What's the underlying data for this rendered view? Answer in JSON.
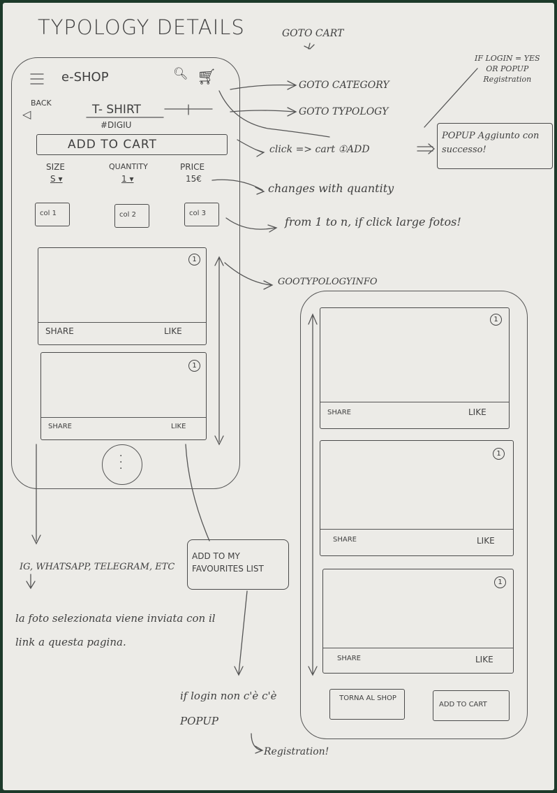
{
  "title": "TYPOLOGY DETAILS",
  "note_goto_cart": "GOTO CART",
  "note_popup_top": "IF LOGIN = YES\nOR POPUP\nRegistration",
  "left_phone": {
    "app_name": "e-SHOP",
    "back_label": "BACK",
    "product_title": "T- SHIRT",
    "product_code": "#DIGIU",
    "add_to_cart": "ADD TO CART",
    "size_label": "SIZE",
    "size_value": "S",
    "quantity_label": "QUANTITY",
    "quantity_value": "1",
    "price_label": "PRICE",
    "price_value": "15€",
    "color_buttons": [
      "col 1",
      "col 2",
      "col 3"
    ],
    "cards": [
      {
        "badge": "1",
        "share": "SHARE",
        "like": "LIKE"
      },
      {
        "badge": "1",
        "share": "SHARE",
        "like": "LIKE"
      }
    ]
  },
  "annotations": {
    "goto_category": "GOTO CATEGORY",
    "goto_typology": "GOTO TYPOLOGY",
    "click_cart": "click => cart ①ADD",
    "popup_box": "POPUP  Aggiunto con successo!",
    "change_quantity": "changes with quantity",
    "photos": "from 1 to n, if click large fotos!",
    "goto_typology_info": "GOOTYPOLOGYINFO",
    "share_list": "IG, WHATSAPP, TELEGRAM, ETC",
    "share_note": "la foto selezionata viene inviata con il link a questa pagina.",
    "add_favourites": "ADD TO MY FAVOURITES LIST",
    "login_note": "if login non c'è  c'è POPUP",
    "registration": "Registration!"
  },
  "right_phone": {
    "cards": [
      {
        "badge": "1",
        "share": "SHARE",
        "like": "LIKE"
      },
      {
        "badge": "1",
        "share": "SHARE",
        "like": "LIKE"
      },
      {
        "badge": "1",
        "share": "SHARE",
        "like": "LIKE"
      }
    ],
    "back_to_shop": "TORNA AL SHOP",
    "add_to_cart": "ADD TO CART"
  }
}
